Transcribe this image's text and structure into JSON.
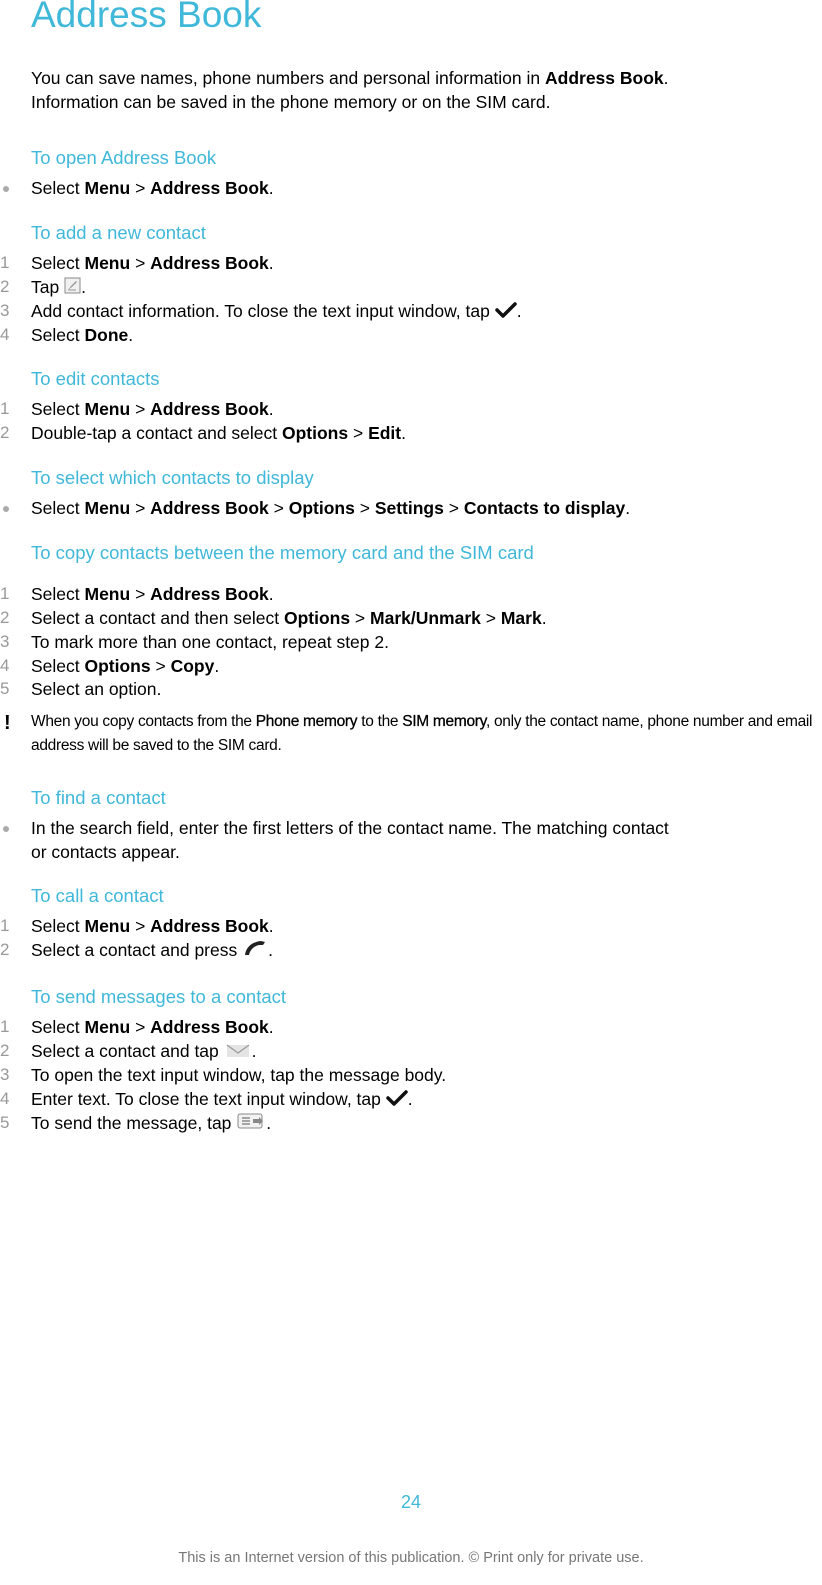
{
  "title": "Address Book",
  "intro": {
    "line1_pre": "You can save names, phone numbers and personal information in ",
    "line1_bold": "Address Book",
    "line1_post": ".",
    "line2": "Information can be saved in the phone memory or on the SIM card."
  },
  "sections": {
    "open": {
      "heading": "To open Address Book",
      "items": [
        {
          "pre": "Select ",
          "b1": "Menu",
          "sep1": " > ",
          "b2": "Address Book",
          "post": "."
        }
      ]
    },
    "add": {
      "heading": "To add a new contact",
      "items": [
        {
          "num": "1",
          "pre": "Select ",
          "b1": "Menu",
          "sep1": " > ",
          "b2": "Address Book",
          "post": "."
        },
        {
          "num": "2",
          "pre": "Tap ",
          "icon": "new-contact-icon",
          "post": "."
        },
        {
          "num": "3",
          "pre": "Add contact information. To close the text input window, tap ",
          "icon": "checkmark-icon",
          "post": "."
        },
        {
          "num": "4",
          "pre": "Select ",
          "b1": "Done",
          "post": "."
        }
      ]
    },
    "edit": {
      "heading": "To edit contacts",
      "items": [
        {
          "num": "1",
          "pre": "Select ",
          "b1": "Menu",
          "sep1": " > ",
          "b2": "Address Book",
          "post": "."
        },
        {
          "num": "2",
          "pre": "Double-tap a contact and select ",
          "b1": "Options",
          "sep1": " > ",
          "b2": "Edit",
          "post": "."
        }
      ]
    },
    "display": {
      "heading": "To select which contacts to display",
      "items": [
        {
          "pre": "Select ",
          "b1": "Menu",
          "sep1": " > ",
          "b2": "Address Book",
          "sep2": " > ",
          "b3": "Options",
          "sep3": " > ",
          "b4": "Settings",
          "sep4": " > ",
          "b5": "Contacts to display",
          "post": "."
        }
      ]
    },
    "copy": {
      "heading": "To copy contacts between the memory card and the SIM card",
      "items": [
        {
          "num": "1",
          "pre": "Select ",
          "b1": "Menu",
          "sep1": " > ",
          "b2": "Address Book",
          "post": "."
        },
        {
          "num": "2",
          "pre": "Select a contact and then select ",
          "b1": "Options",
          "sep1": " > ",
          "b2": "Mark/Unmark",
          "sep2": " > ",
          "b3": "Mark",
          "post": "."
        },
        {
          "num": "3",
          "pre": "To mark more than one contact, repeat step 2."
        },
        {
          "num": "4",
          "pre": "Select ",
          "b1": "Options",
          "sep1": " > ",
          "b2": "Copy",
          "post": "."
        },
        {
          "num": "5",
          "pre": "Select an option."
        }
      ],
      "note": {
        "icon": "!",
        "pre": "When you copy contacts from the ",
        "b1": "Phone memory",
        "mid": " to the ",
        "b2": "SIM memory",
        "post": ", only the contact name, phone number and email address will be saved to the SIM card."
      }
    },
    "find": {
      "heading": "To find a contact",
      "items": [
        {
          "pre": "In the search field, enter the first letters of the contact name. The matching contact",
          "line2": "or contacts appear."
        }
      ]
    },
    "call": {
      "heading": "To call a contact",
      "items": [
        {
          "num": "1",
          "pre": "Select ",
          "b1": "Menu",
          "sep1": " > ",
          "b2": "Address Book",
          "post": "."
        },
        {
          "num": "2",
          "pre": "Select a contact and press ",
          "icon": "phone-call-icon",
          "post": "."
        }
      ]
    },
    "message": {
      "heading": "To send messages to a contact",
      "items": [
        {
          "num": "1",
          "pre": "Select ",
          "b1": "Menu",
          "sep1": " > ",
          "b2": "Address Book",
          "post": "."
        },
        {
          "num": "2",
          "pre": "Select a contact and tap ",
          "icon": "envelope-icon",
          "post": "."
        },
        {
          "num": "3",
          "pre": "To open the text input window, tap the message body."
        },
        {
          "num": "4",
          "pre": "Enter text. To close the text input window, tap ",
          "icon": "checkmark-icon",
          "post": "."
        },
        {
          "num": "5",
          "pre": "To send the message, tap ",
          "icon": "send-message-icon",
          "post": "."
        }
      ]
    }
  },
  "page_number": "24",
  "footer": "This is an Internet version of this publication. © Print only for private use."
}
